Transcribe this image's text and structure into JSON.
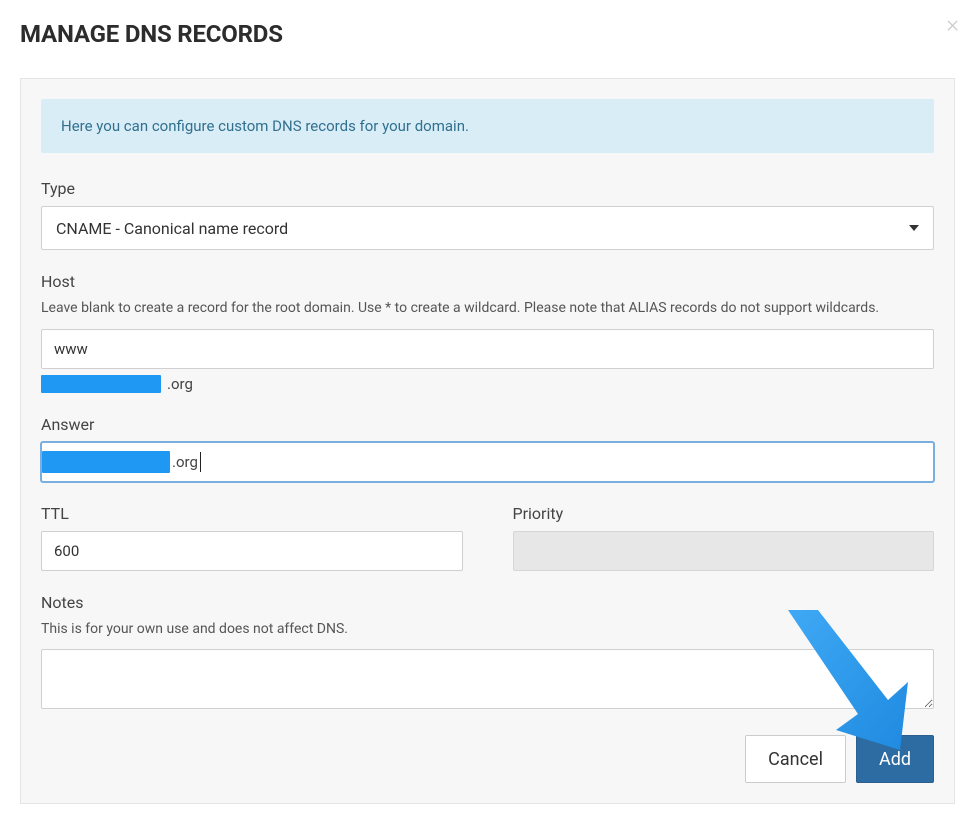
{
  "modal": {
    "title": "MANAGE DNS RECORDS",
    "close_symbol": "×"
  },
  "banner": {
    "text": "Here you can configure custom DNS records for your domain."
  },
  "fields": {
    "type": {
      "label": "Type",
      "value": "CNAME - Canonical name record"
    },
    "host": {
      "label": "Host",
      "help": "Leave blank to create a record for the root domain. Use * to create a wildcard. Please note that ALIAS records do not support wildcards.",
      "value": "www",
      "domain_suffix": ".org"
    },
    "answer": {
      "label": "Answer",
      "domain_suffix": ".org"
    },
    "ttl": {
      "label": "TTL",
      "value": "600"
    },
    "priority": {
      "label": "Priority",
      "value": ""
    },
    "notes": {
      "label": "Notes",
      "help": "This is for your own use and does not affect DNS.",
      "value": ""
    }
  },
  "buttons": {
    "cancel": "Cancel",
    "add": "Add"
  }
}
